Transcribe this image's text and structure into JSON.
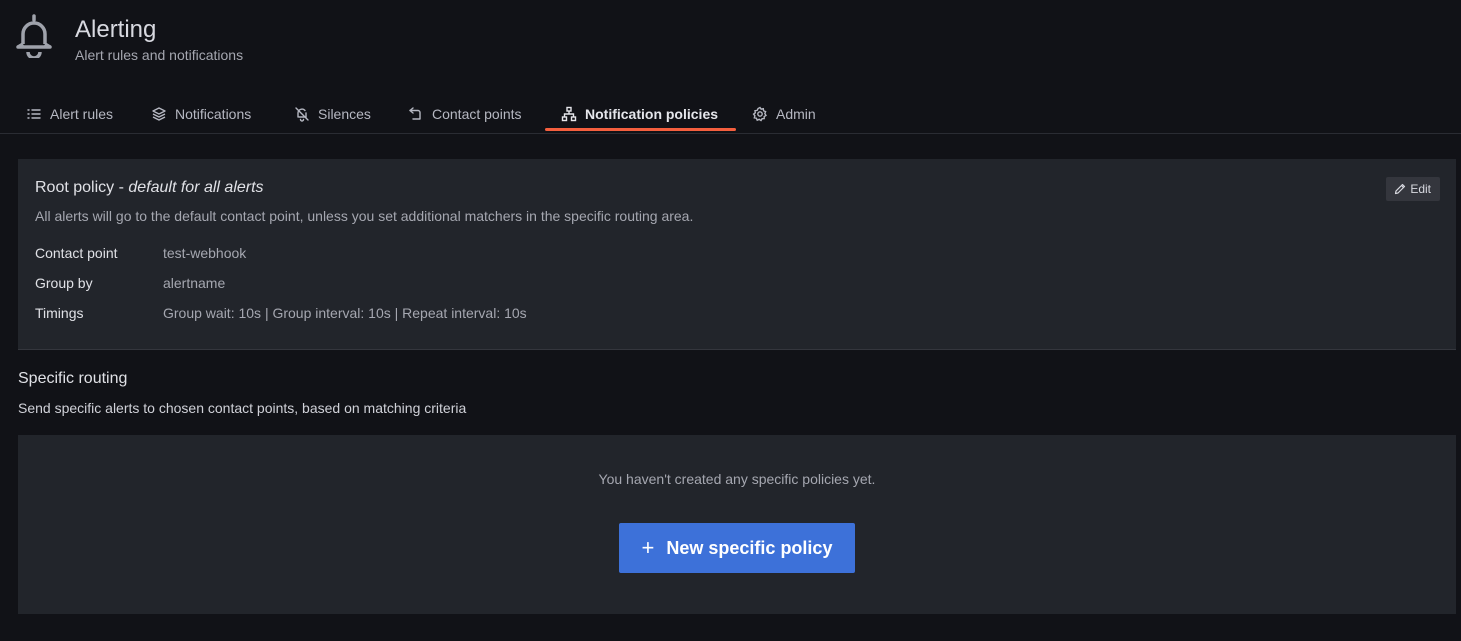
{
  "header": {
    "icon": "bell-icon",
    "title": "Alerting",
    "subtitle": "Alert rules and notifications"
  },
  "tabs": [
    {
      "label": "Alert rules",
      "icon": "list-icon",
      "active": false
    },
    {
      "label": "Notifications",
      "icon": "layers-icon",
      "active": false
    },
    {
      "label": "Silences",
      "icon": "bell-slash-icon",
      "active": false
    },
    {
      "label": "Contact points",
      "icon": "comment-alt-share-icon",
      "active": false
    },
    {
      "label": "Notification policies",
      "icon": "sitemap-icon",
      "active": true
    },
    {
      "label": "Admin",
      "icon": "cog-icon",
      "active": false
    }
  ],
  "root_policy": {
    "title": "Root policy - ",
    "title_emphasis": "default for all alerts",
    "description": "All alerts will go to the default contact point, unless you set additional matchers in the specific routing area.",
    "edit_label": "Edit",
    "details": [
      {
        "label": "Contact point",
        "value": "test-webhook"
      },
      {
        "label": "Group by",
        "value": "alertname"
      },
      {
        "label": "Timings",
        "value": "Group wait: 10s | Group interval: 10s | Repeat interval: 10s"
      }
    ]
  },
  "specific_routing": {
    "title": "Specific routing",
    "description": "Send specific alerts to chosen contact points, based on matching criteria",
    "empty_text": "You haven't created any specific policies yet.",
    "new_button_label": "New specific policy"
  },
  "colors": {
    "background": "#111217",
    "panel": "#22252b",
    "accent_tab": "#f55f3e",
    "primary_button": "#3d71d9"
  }
}
